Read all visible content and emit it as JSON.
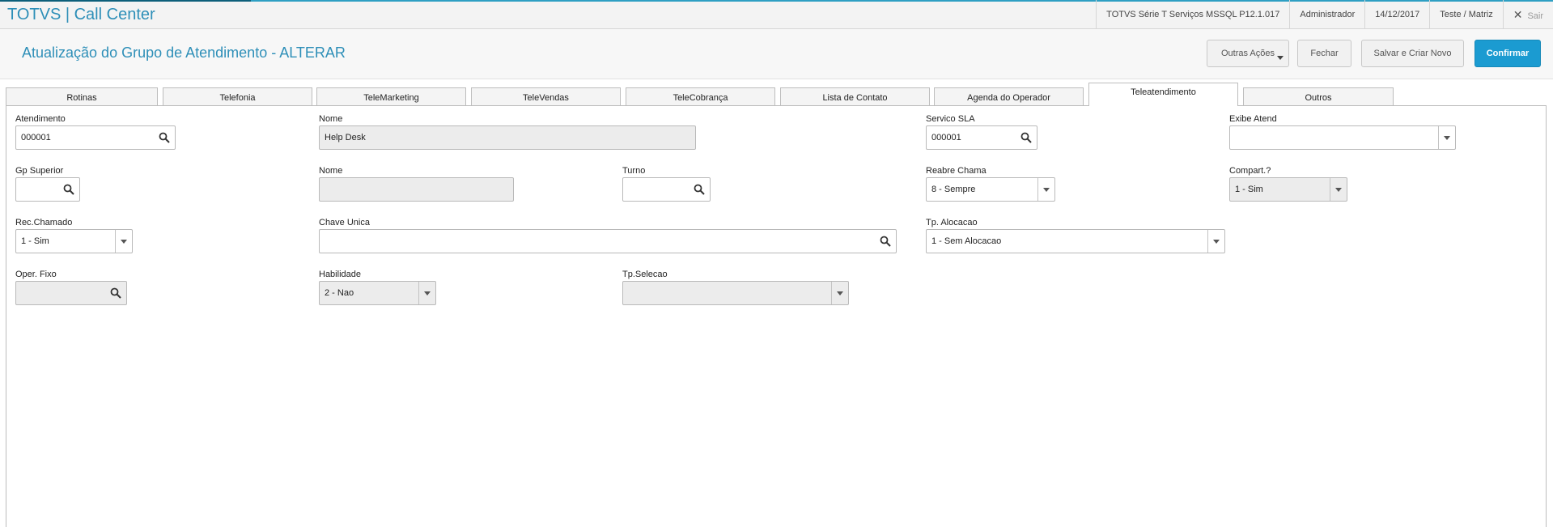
{
  "app": {
    "title": "TOTVS | Call Center"
  },
  "header": {
    "environment": "TOTVS Série T Serviços MSSQL P12.1.017",
    "user": "Administrador",
    "date": "14/12/2017",
    "branch": "Teste / Matriz",
    "exit_label": "Sair"
  },
  "page": {
    "title": "Atualização do Grupo de Atendimento - ALTERAR"
  },
  "actions": {
    "other_actions": "Outras Ações",
    "close": "Fechar",
    "save_new": "Salvar e Criar Novo",
    "confirm": "Confirmar"
  },
  "tabs": [
    {
      "label": "Rotinas"
    },
    {
      "label": "Telefonia"
    },
    {
      "label": "TeleMarketing"
    },
    {
      "label": "TeleVendas"
    },
    {
      "label": "TeleCobrança"
    },
    {
      "label": "Lista de Contato"
    },
    {
      "label": "Agenda do Operador"
    },
    {
      "label": "Teleatendimento"
    },
    {
      "label": "Outros"
    }
  ],
  "active_tab": "Teleatendimento",
  "form": {
    "atendimento": {
      "label": "Atendimento",
      "value": "000001"
    },
    "nome1": {
      "label": "Nome",
      "value": "Help Desk"
    },
    "servico_sla": {
      "label": "Servico SLA",
      "value": "000001"
    },
    "exibe_atend": {
      "label": "Exibe Atend",
      "value": ""
    },
    "gp_superior": {
      "label": "Gp Superior",
      "value": ""
    },
    "nome2": {
      "label": "Nome",
      "value": ""
    },
    "turno": {
      "label": "Turno",
      "value": ""
    },
    "reabre_chama": {
      "label": "Reabre Chama",
      "value": "8 - Sempre"
    },
    "compart": {
      "label": "Compart.?",
      "value": "1 - Sim"
    },
    "rec_chamado": {
      "label": "Rec.Chamado",
      "value": "1 - Sim"
    },
    "chave_unica": {
      "label": "Chave Unica",
      "value": ""
    },
    "tp_alocacao": {
      "label": "Tp. Alocacao",
      "value": "1 - Sem Alocacao"
    },
    "oper_fixo": {
      "label": "Oper. Fixo",
      "value": ""
    },
    "habilidade": {
      "label": "Habilidade",
      "value": "2 - Nao"
    },
    "tp_selecao": {
      "label": "Tp.Selecao",
      "value": ""
    }
  },
  "icons": {
    "search": "search-icon",
    "dropdown": "chevron-down-icon",
    "exit": "close-icon"
  },
  "colors": {
    "accent": "#2e8fb8",
    "primary_button": "#1b9bd1"
  }
}
